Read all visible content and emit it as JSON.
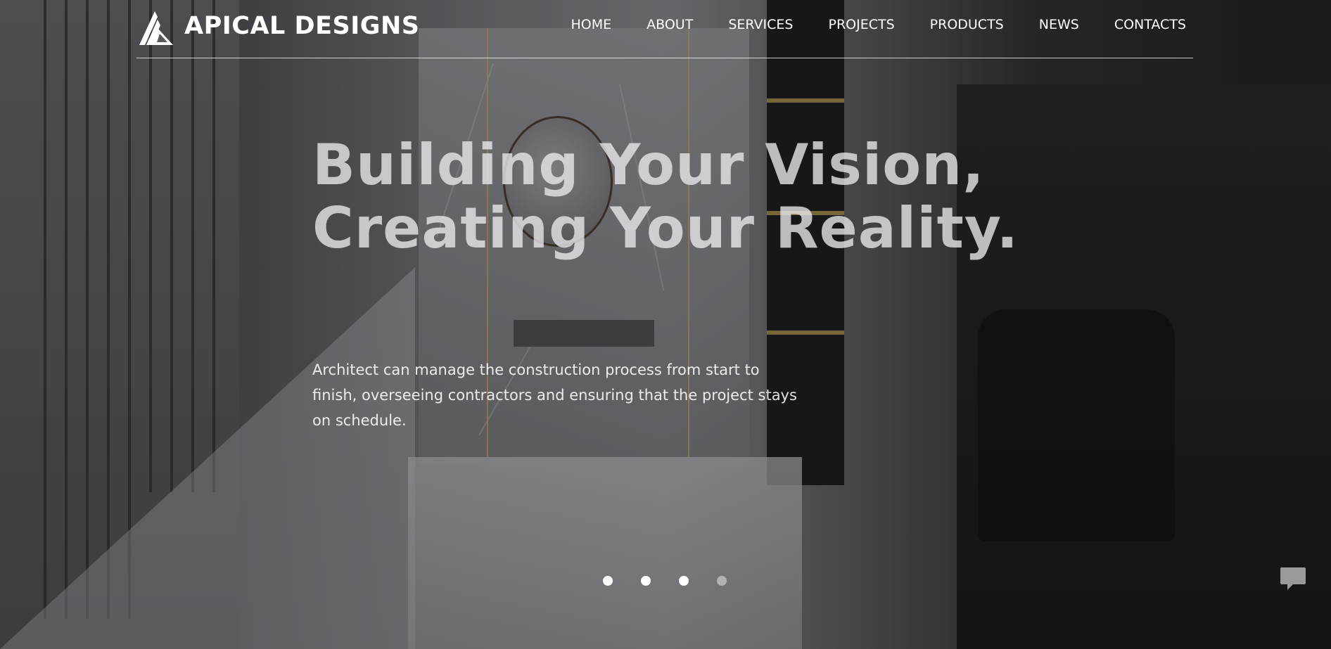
{
  "brand": {
    "name": "APICAL DESIGNS",
    "logo_icon": "triangle-logo-icon"
  },
  "nav": {
    "items": [
      {
        "label": "HOME"
      },
      {
        "label": "ABOUT"
      },
      {
        "label": "SERVICES"
      },
      {
        "label": "PROJECTS"
      },
      {
        "label": "PRODUCTS"
      },
      {
        "label": "NEWS"
      },
      {
        "label": "CONTACTS"
      }
    ]
  },
  "hero": {
    "title_line1": "Building Your Vision,",
    "title_line2": "Creating Your Reality.",
    "description": "Architect can manage the construction process from start to finish, overseeing contractors and ensuring that the project stays on schedule."
  },
  "slider": {
    "total_slides": 4,
    "active_slide": 4
  },
  "chat": {
    "icon": "chat-bubble-icon"
  },
  "colors": {
    "text": "#ffffff",
    "title": "#ebebee",
    "accent_gold": "#c7a55a"
  }
}
